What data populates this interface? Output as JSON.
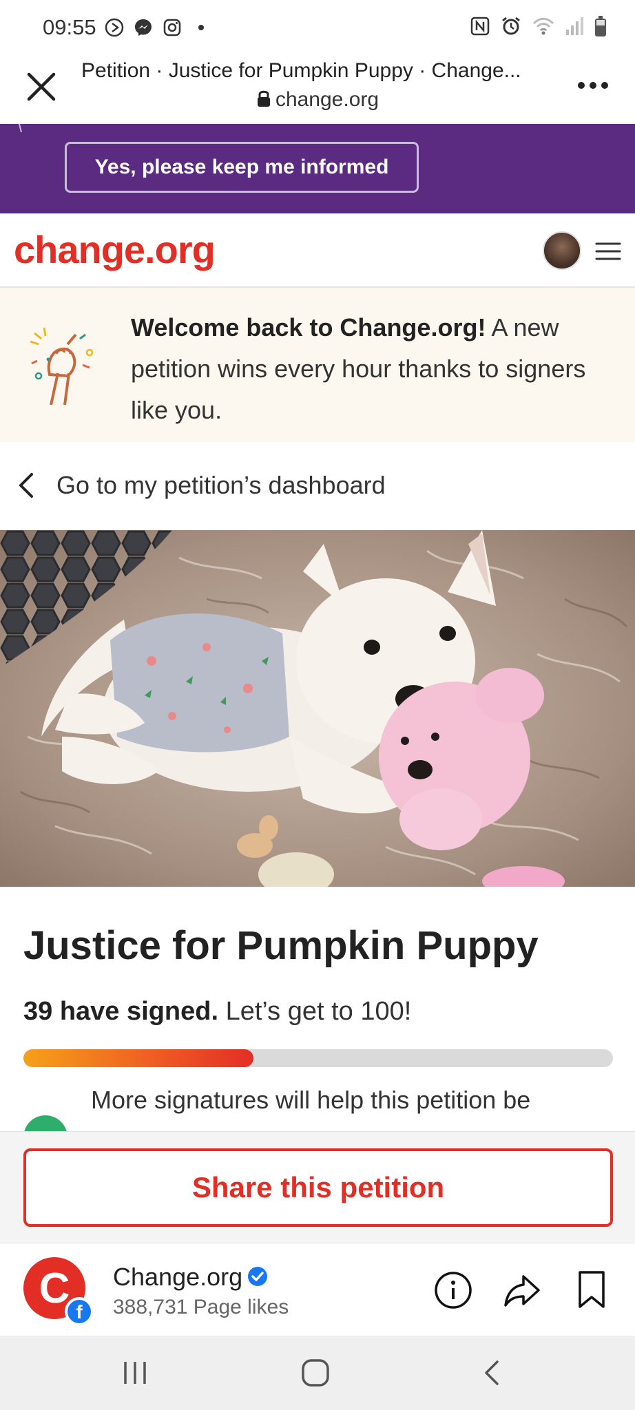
{
  "status_bar": {
    "time": "09:55"
  },
  "browser": {
    "tab_title": "Petition · Justice for Pumpkin Puppy · Change...",
    "url": "change.org"
  },
  "banner": {
    "keep_informed_label": "Yes, please keep me informed",
    "color": "#5b2b82"
  },
  "header": {
    "logo_text": "change.org",
    "brand_color": "#e32e26"
  },
  "welcome": {
    "bold": "Welcome back to Change.org!",
    "rest": " A new petition wins every hour thanks to signers like you."
  },
  "dashboard_link": {
    "label": "Go to my petition’s dashboard"
  },
  "petition": {
    "title": "Justice for Pumpkin Puppy",
    "signed_bold": "39 have signed.",
    "signed_rest": " Let’s get to 100!",
    "progress_fraction": 0.39,
    "more_signatures_text": "More signatures will help this petition be"
  },
  "share": {
    "label": "Share this petition"
  },
  "facebook_bar": {
    "page_name": "Change.org",
    "logo_letter": "C",
    "badge_letter": "f",
    "page_likes": "388,731 Page likes"
  },
  "icons": [
    "close-icon",
    "more-icon",
    "lock-icon",
    "hamburger-icon",
    "chevron-left-icon",
    "info-icon",
    "share-icon",
    "bookmark-icon",
    "verified-icon"
  ]
}
